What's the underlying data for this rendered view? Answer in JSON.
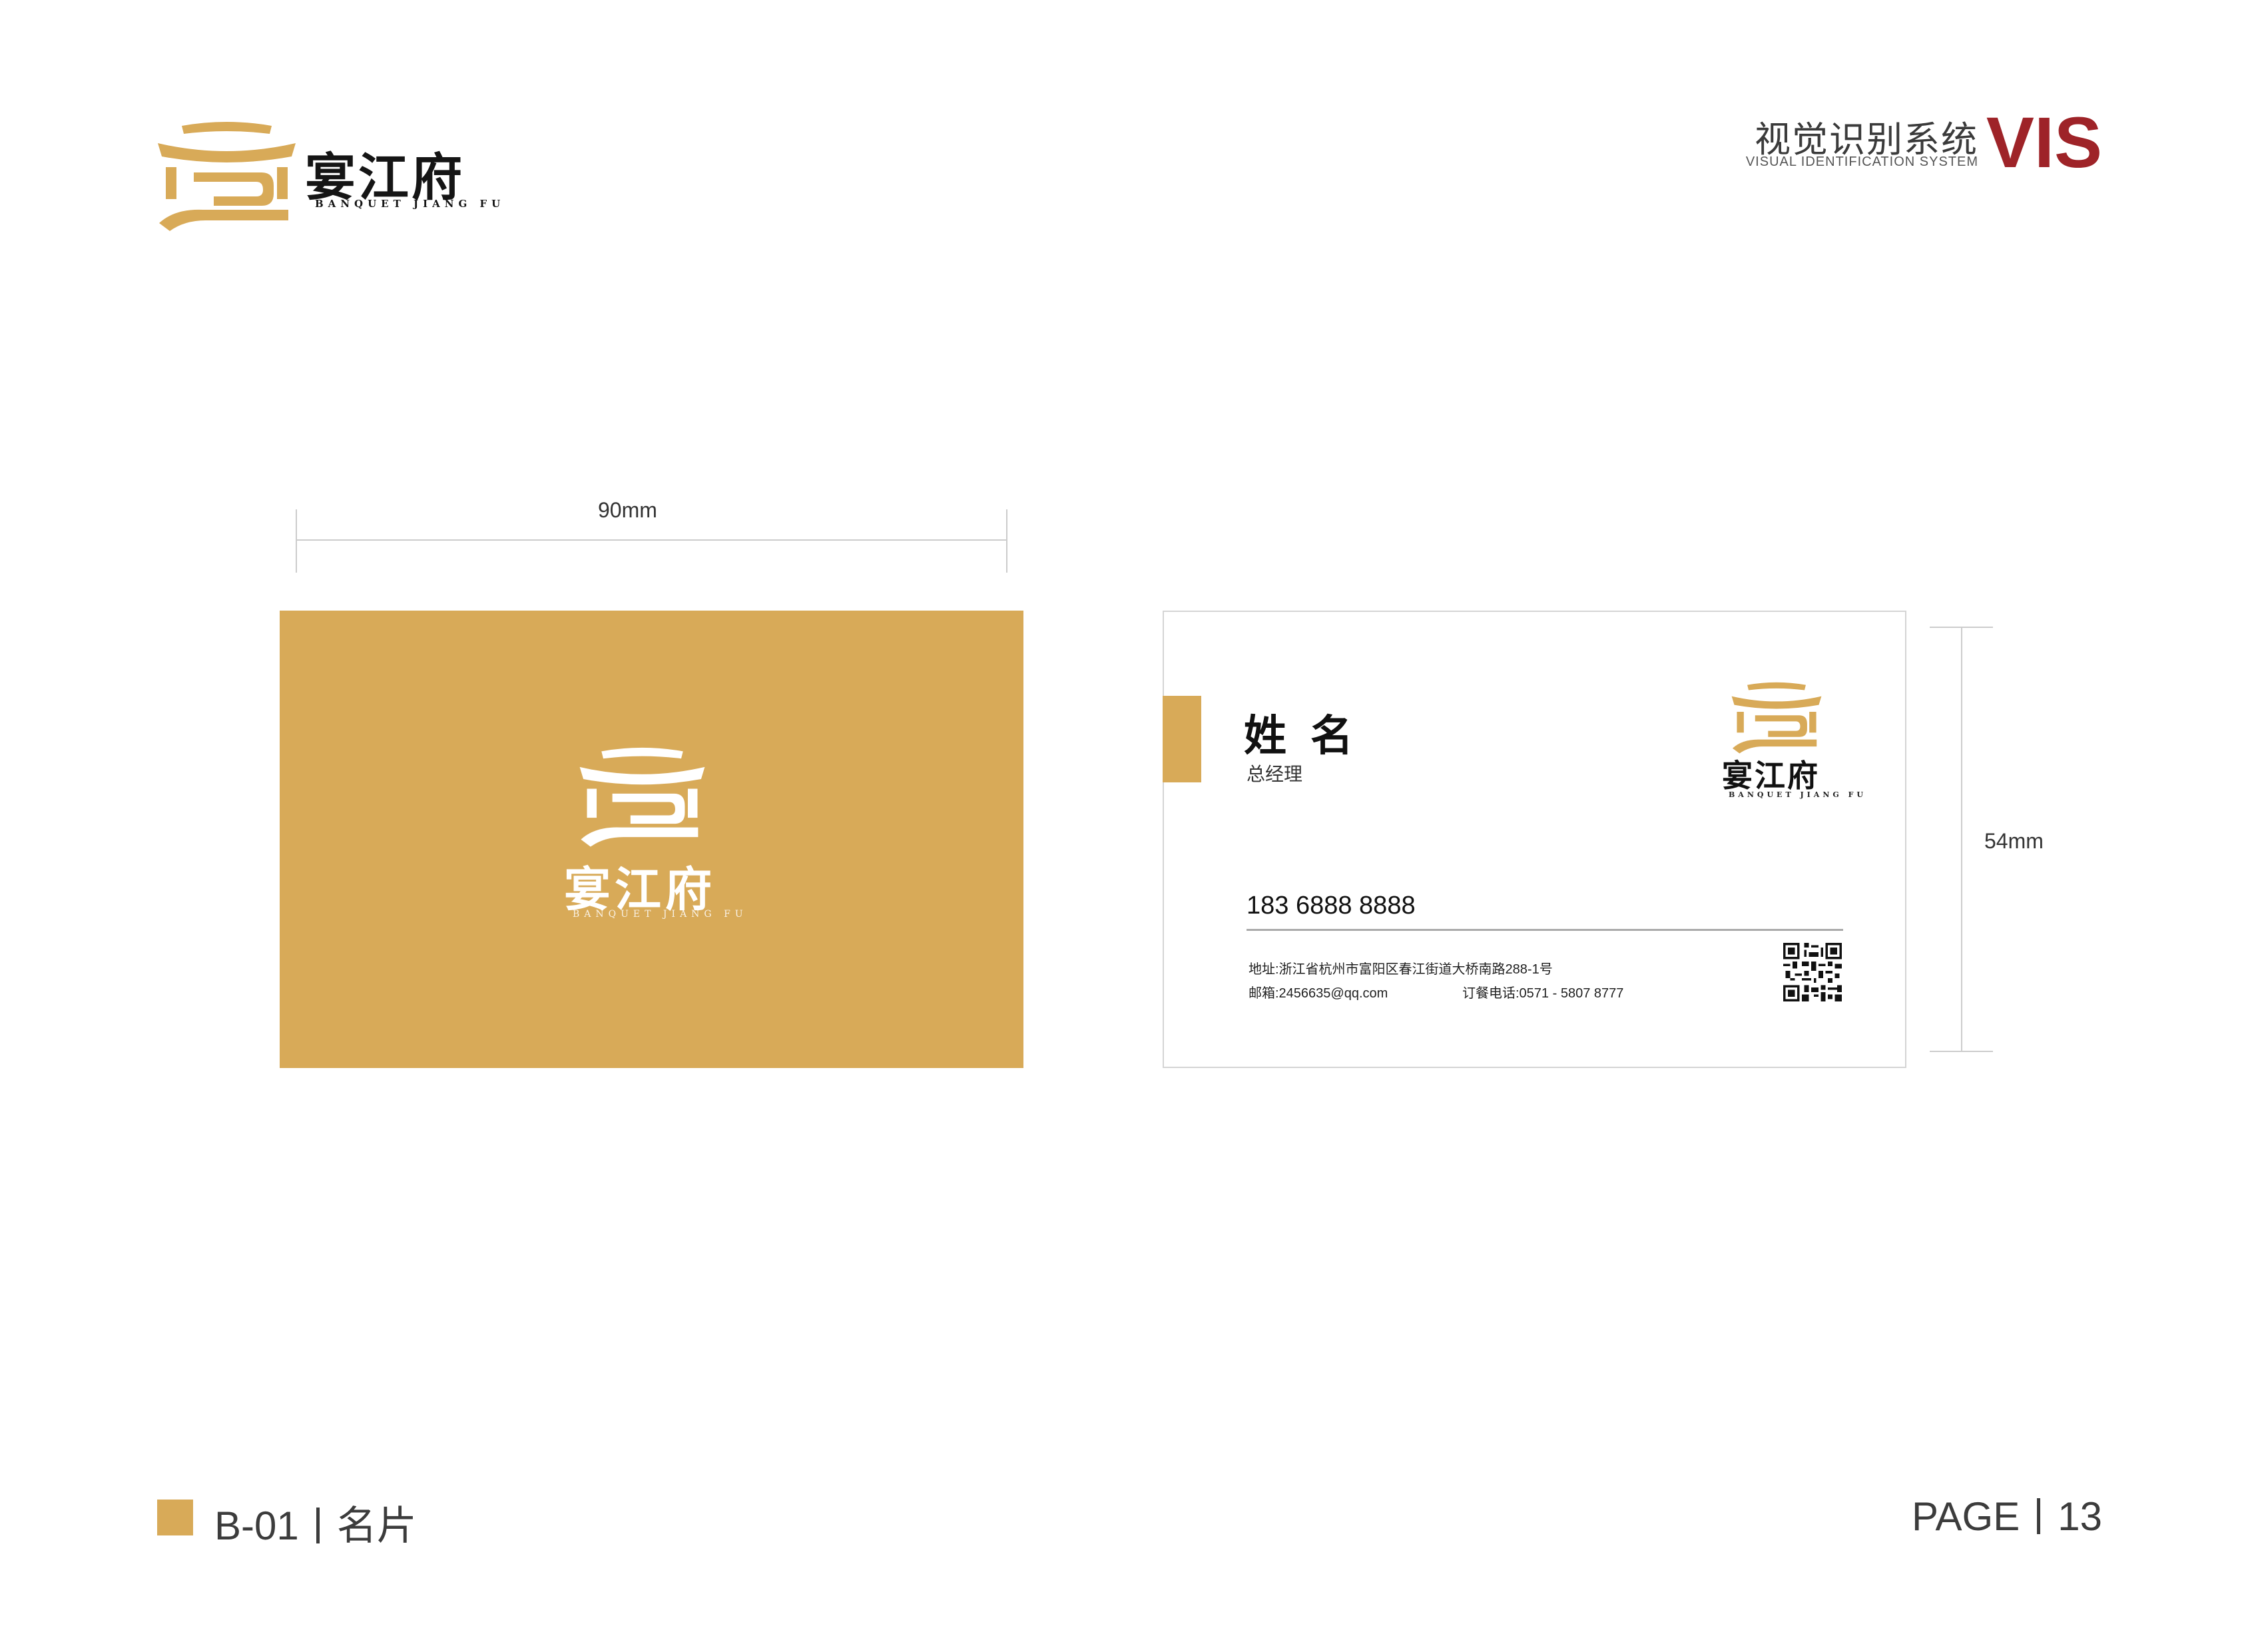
{
  "brand": {
    "name_cn": "宴江府",
    "name_en": "BANQUET JIANG FU",
    "color_gold": "#d8aa58",
    "color_red": "#9e2328"
  },
  "header": {
    "vis_cn": "视觉识别系统",
    "vis_en": "VISUAL IDENTIFICATION SYSTEM",
    "vis_label": "VIS"
  },
  "dimensions": {
    "width": "90mm",
    "height": "54mm"
  },
  "card_back": {
    "name": "姓名",
    "title": "总经理",
    "phone": "183 6888 8888",
    "address": "地址:浙江省杭州市富阳区春江街道大桥南路288-1号",
    "email": "邮箱:2456635@qq.com",
    "tel": "订餐电话:0571 - 5807 8777",
    "qr_icon": "qr-code-icon"
  },
  "footer": {
    "code": "B-01",
    "section": "名片",
    "page_label": "PAGE",
    "page_number": "13"
  }
}
